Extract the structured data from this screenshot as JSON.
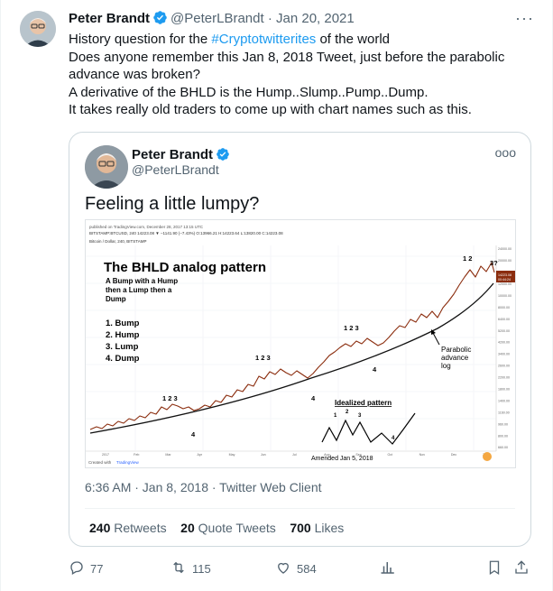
{
  "tweet": {
    "author_name": "Peter Brandt",
    "handle": "@PeterLBrandt",
    "dot": "·",
    "date": "Jan 20, 2021",
    "more": "···",
    "line1_prefix": "History question for the ",
    "hashtag": "#Cryptotwitterites",
    "line1_suffix": " of the world",
    "line2": "Does anyone remember this Jan 8, 2018 Tweet, just before the parabolic advance was broken?",
    "line3": "A derivative of the BHLD is the Hump..Slump..Pump..Dump.",
    "line4": "It takes really old traders to come up with chart names such as this."
  },
  "quote": {
    "author_name": "Peter Brandt",
    "handle": "@PeterLBrandt",
    "more": "ooo",
    "text": "Feeling a little lumpy?",
    "timestamp": "6:36 AM · Jan 8, 2018 · Twitter Web Client",
    "retweets_count": "240",
    "retweets_label": "Retweets",
    "quotes_count": "20",
    "quotes_label": "Quote Tweets",
    "likes_count": "700",
    "likes_label": "Likes"
  },
  "chart": {
    "header_small": "published on TradingView.com, December 28, 2017 13:15 UTC",
    "symbol_line": "BITSTAMP:BTCUSD, 240  14223.08 ▼ −1141.90 (−7.43%)  O:13966.21  H:14223.64  L:13820.00  C:14223.08",
    "pair": "Bitcoin / Dollar, 240, BITSTAMP",
    "title": "The BHLD analog pattern",
    "subtitle1": "A Bump with a Hump",
    "subtitle2": "then a Lump then a",
    "subtitle3": "Dump",
    "list": [
      "1. Bump",
      "2. Hump",
      "3. Lump",
      "4. Dump"
    ],
    "parabolic1": "Parabolic",
    "parabolic2": "advance",
    "parabolic3": "log",
    "idealized": "Idealized pattern",
    "amended": "Amended Jan 5, 2018",
    "created_with": "Created with",
    "tv": "TradingView",
    "price_tag": "14223.08",
    "price_tag2": "00:44:24",
    "labels_123": [
      "1  2  3",
      "1    2   3",
      "1    2 3",
      "1   2",
      "1  2  3"
    ],
    "label_3q": "3?",
    "label_4": "4",
    "y_ticks": [
      "24000.00",
      "20000.00",
      "16000.00",
      "12000.00",
      "10000.00",
      "8000.00",
      "6400.00",
      "5200.00",
      "4200.00",
      "3400.00",
      "2600.00",
      "2200.00",
      "1800.00",
      "1400.00",
      "1160.00",
      "960.00",
      "800.00",
      "660.00"
    ],
    "x_ticks": [
      "2017",
      "Feb",
      "Mar",
      "Apr",
      "May",
      "Jun",
      "Jul",
      "Aug",
      "Sep",
      "Oct",
      "Nov",
      "Dec",
      "2018"
    ],
    "ideal_nums": [
      "1",
      "2",
      "3",
      "4"
    ]
  },
  "actions": {
    "reply_count": "77",
    "retweet_count": "115",
    "like_count": "584"
  },
  "colors": {
    "accent": "#1d9bf0",
    "muted": "#536471",
    "text": "#0f1419"
  }
}
